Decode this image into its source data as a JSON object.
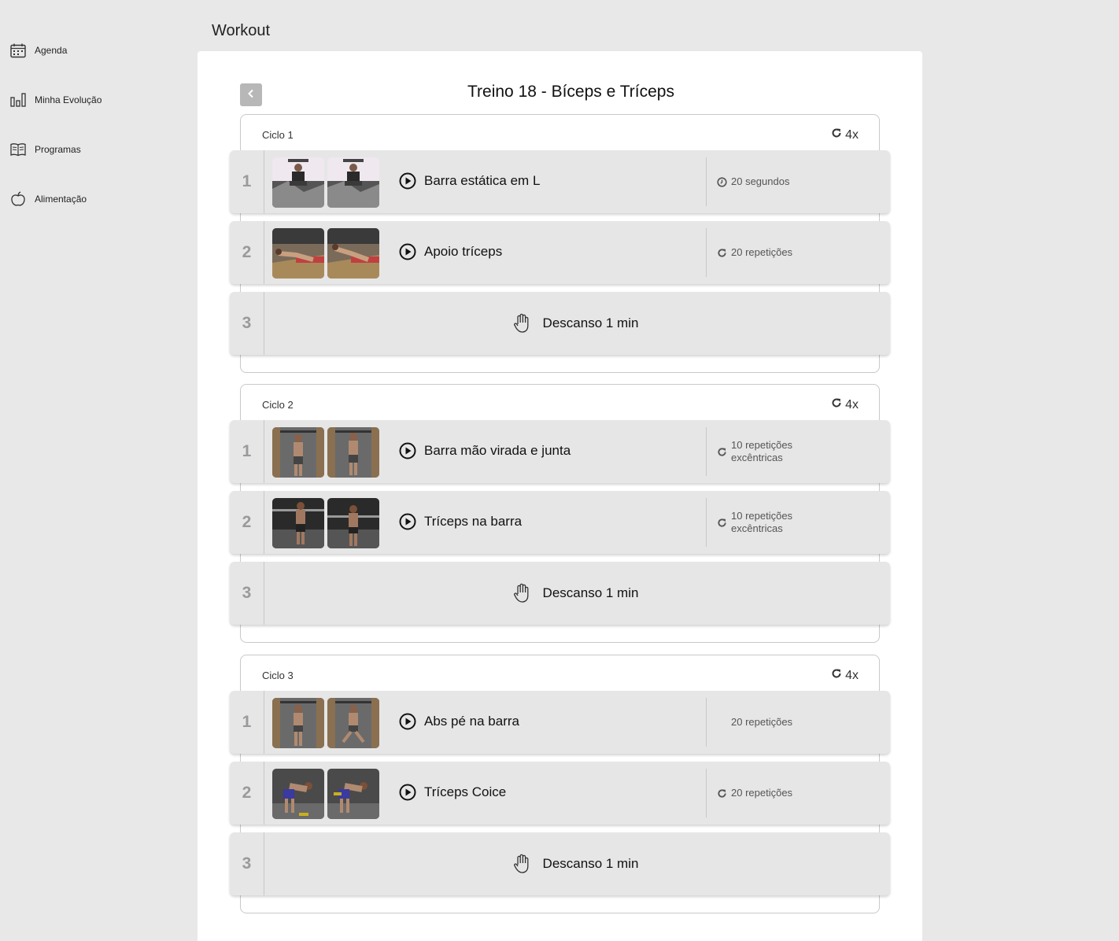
{
  "header": {
    "title": "Workout"
  },
  "sidebar": {
    "items": [
      {
        "label": "Agenda",
        "icon": "calendar-icon"
      },
      {
        "label": "Minha Evolução",
        "icon": "bar-chart-icon"
      },
      {
        "label": "Programas",
        "icon": "book-icon"
      },
      {
        "label": "Alimentação",
        "icon": "apple-icon"
      }
    ]
  },
  "workout": {
    "title": "Treino 18 - Bíceps e Tríceps",
    "colors": {
      "panel": "#ffffff",
      "background": "#e8e8e8",
      "row": "#e6e6e6",
      "back_button": "#b7b7b7"
    },
    "cycles": [
      {
        "label": "Ciclo 1",
        "repeat": "4x",
        "rows": [
          {
            "num": "1",
            "name": "Barra estática em L",
            "detail": "20 segundos",
            "detail_icon": "clock-icon"
          },
          {
            "num": "2",
            "name": "Apoio tríceps",
            "detail": "20 repetições",
            "detail_icon": "repeat-icon"
          },
          {
            "num": "3",
            "rest": "Descanso 1 min"
          }
        ]
      },
      {
        "label": "Ciclo 2",
        "repeat": "4x",
        "rows": [
          {
            "num": "1",
            "name": "Barra mão virada e junta",
            "detail": "10 repetições excêntricas",
            "detail_icon": "repeat-icon"
          },
          {
            "num": "2",
            "name": "Tríceps na barra",
            "detail": "10 repetições excêntricas",
            "detail_icon": "repeat-icon"
          },
          {
            "num": "3",
            "rest": "Descanso 1 min"
          }
        ]
      },
      {
        "label": "Ciclo 3",
        "repeat": "4x",
        "rows": [
          {
            "num": "1",
            "name": "Abs pé na barra",
            "detail": "20 repetições",
            "detail_icon": ""
          },
          {
            "num": "2",
            "name": "Tríceps Coice",
            "detail": "20 repetições",
            "detail_icon": "repeat-icon"
          },
          {
            "num": "3",
            "rest": "Descanso 1 min"
          }
        ]
      }
    ]
  }
}
